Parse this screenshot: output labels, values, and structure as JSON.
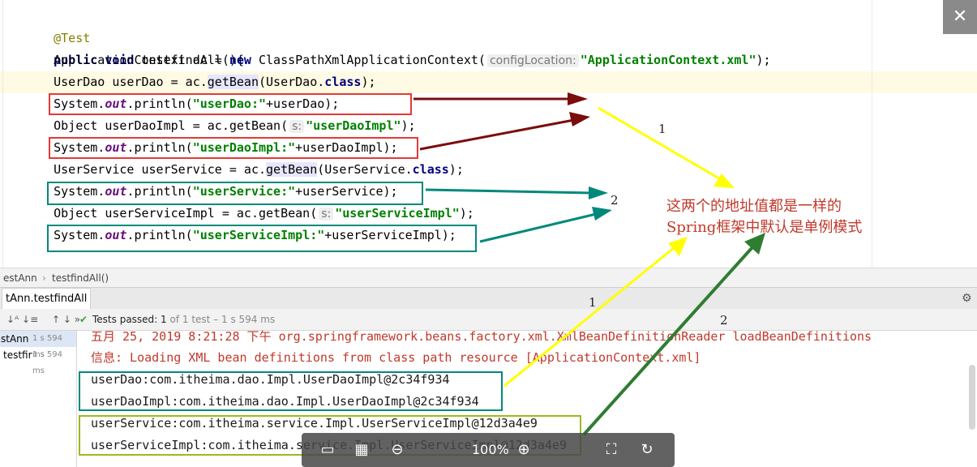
{
  "editor": {
    "annotation": "@Test",
    "method_sig": {
      "mods": "public void",
      "name": " testfindAll(){"
    },
    "lines": {
      "l1": {
        "a": "    ApplicationContext ac = ",
        "kw": "new",
        "b": " ClassPathXmlApplicationContext(",
        "hint": "configLocation:",
        "str": "\"ApplicationContext.xml\"",
        "c": ");"
      },
      "l2": {
        "a": "    UserDao userDao = ac.",
        "m": "getBean",
        "b": "(UserDao.",
        "kw": "class",
        "c": ");"
      },
      "l3": {
        "a": "    System.",
        "f": "out",
        "b": ".println(",
        "str": "\"userDao:\"",
        "c": "+userDao);"
      },
      "l4": {
        "a": "    Object userDaoImpl = ac.getBean(",
        "hint": "s:",
        "str": "\"userDaoImpl\"",
        "c": ");"
      },
      "l5": {
        "a": "    System.",
        "f": "out",
        "b": ".println(",
        "str": "\"userDaoImpl:\"",
        "c": "+userDaoImpl);"
      },
      "l6": {
        "a": "    UserService userService = ac.",
        "m": "getBean",
        "b": "(UserService.",
        "kw": "class",
        "c": ");"
      },
      "l7": {
        "a": "    System.",
        "f": "out",
        "b": ".println(",
        "str": "\"userService:\"",
        "c": "+userService);"
      },
      "l8": {
        "a": "    Object userServiceImpl = ac.getBean(",
        "hint": "s:",
        "str": "\"userServiceImpl\"",
        "c": ");"
      },
      "l9": {
        "a": "    System.",
        "f": "out",
        "b": ".println(",
        "str": "\"userServiceImpl:\"",
        "c": "+userServiceImpl);"
      }
    },
    "closing": "}",
    "close_button": "✕"
  },
  "breadcrumb": {
    "class": "estAnn",
    "sep": "›",
    "method": "testfindAll()"
  },
  "run": {
    "tab": "tAnn.testfindAll",
    "sort_icons": "↓ᴬ ↓≡",
    "nav": "↑ ↓ »",
    "status_prefix": "Tests passed:",
    "status_count": "1",
    "status_rest": "of 1 test – 1 s 594 ms",
    "tree": [
      {
        "name": "stAnn",
        "time": "1 s 594 ms"
      },
      {
        "name": "testfir",
        "time": "1 s 594 ms"
      }
    ]
  },
  "console": {
    "log1": "五月 25, 2019 8:21:28 下午 org.springframework.beans.factory.xml.XmlBeanDefinitionReader loadBeanDefinitions",
    "log2": "信息: Loading XML bean definitions from class path resource [ApplicationContext.xml]",
    "out1": "userDao:com.itheima.dao.Impl.UserDaoImpl@2c34f934",
    "out2": "userDaoImpl:com.itheima.dao.Impl.UserDaoImpl@2c34f934",
    "out3": "userService:com.itheima.service.Impl.UserServiceImpl@12d3a4e9",
    "out4": "userServiceImpl:com.itheima.service.Impl.UserServiceImpl@12d3a4e9"
  },
  "annotations": {
    "note_line1": "这两个的地址值都是一样的",
    "note_line2": "Spring框架中默认是单例模式",
    "n1_top": "1",
    "n2_top": "2",
    "n1_bottom": "1",
    "n2_bottom": "2"
  },
  "viewer": {
    "zoom": "100%"
  },
  "colors": {
    "red_box": "#e53935",
    "teal_box": "#00897b",
    "green_box": "#9bbb1c",
    "arrow_dark": "#7b0d0d",
    "arrow_yellow": "#ffff00",
    "arrow_green": "#2e7d32"
  }
}
